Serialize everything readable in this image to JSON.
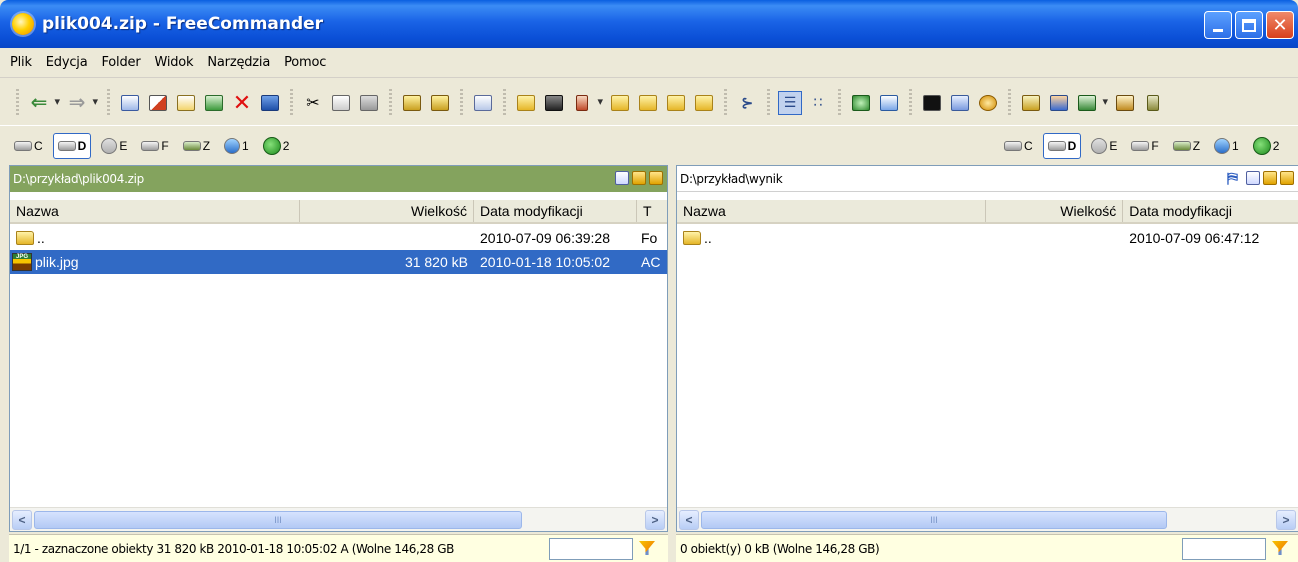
{
  "window": {
    "title": "plik004.zip - FreeCommander"
  },
  "menu": [
    "Plik",
    "Edycja",
    "Folder",
    "Widok",
    "Narzędzia",
    "Pomoc"
  ],
  "drives": [
    {
      "label": "C",
      "icon": "hdd-icon"
    },
    {
      "label": "D",
      "icon": "hdd-icon",
      "selected": true
    },
    {
      "label": "E",
      "icon": "cd-icon"
    },
    {
      "label": "F",
      "icon": "hdd-icon"
    },
    {
      "label": "Z",
      "icon": "network-drive-icon"
    },
    {
      "label": "1",
      "icon": "network-icon"
    },
    {
      "label": "2",
      "icon": "ftp-icon"
    }
  ],
  "left": {
    "path": "D:\\przykład\\plik004.zip",
    "columns": [
      "Nazwa",
      "Wielkość",
      "Data modyfikacji",
      "T"
    ],
    "rows": [
      {
        "name": "..",
        "size": "",
        "date": "2010-07-09 06:39:28",
        "type": "Fo",
        "icon": "folder-up-icon"
      },
      {
        "name": "plik.jpg",
        "size": "31 820 kB",
        "date": "2010-01-18 10:05:02",
        "type": "AC",
        "icon": "jpg-file-icon",
        "selected": true
      }
    ],
    "status": "1/1 - zaznaczone obiekty  31 820 kB  2010-01-18 10:05:02  A  (Wolne 146,28 GB"
  },
  "right": {
    "path": "D:\\przykład\\wynik",
    "columns": [
      "Nazwa",
      "Wielkość",
      "Data modyfikacji"
    ],
    "rows": [
      {
        "name": "..",
        "size": "",
        "date": "2010-07-09 06:47:12",
        "icon": "folder-up-icon"
      }
    ],
    "status": "0 obiekt(y)  0 kB   (Wolne 146,28 GB)"
  },
  "scroll": {
    "thumb_grip": "III",
    "left_arrow": "<",
    "right_arrow": ">"
  },
  "colors": {
    "titlebar": "#0a4fd6",
    "left_path_bg": "#84a35e",
    "selection": "#316ac5",
    "status_bg": "#ffffe1"
  }
}
